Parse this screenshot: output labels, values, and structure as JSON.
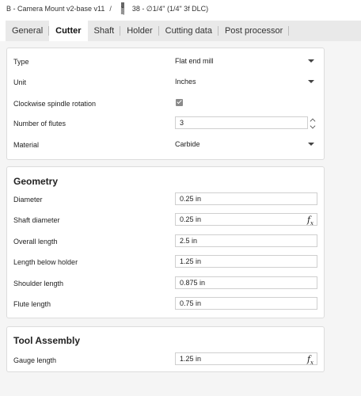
{
  "breadcrumb": {
    "document": "B - Camera Mount v2-base v11",
    "separator": "/",
    "tool": "38 - ∅1/4\" (1/4\" 3f DLC)"
  },
  "tabs": [
    {
      "label": "General",
      "active": false
    },
    {
      "label": "Cutter",
      "active": true
    },
    {
      "label": "Shaft",
      "active": false
    },
    {
      "label": "Holder",
      "active": false
    },
    {
      "label": "Cutting data",
      "active": false
    },
    {
      "label": "Post processor",
      "active": false
    }
  ],
  "cutter": {
    "type_label": "Type",
    "type_value": "Flat end mill",
    "unit_label": "Unit",
    "unit_value": "Inches",
    "clockwise_label": "Clockwise spindle rotation",
    "clockwise_checked": true,
    "flutes_label": "Number of flutes",
    "flutes_value": "3",
    "material_label": "Material",
    "material_value": "Carbide"
  },
  "geometry": {
    "title": "Geometry",
    "diameter_label": "Diameter",
    "diameter_value": "0.25 in",
    "shaft_diameter_label": "Shaft diameter",
    "shaft_diameter_value": "0.25 in",
    "overall_length_label": "Overall length",
    "overall_length_value": "2.5 in",
    "length_below_holder_label": "Length below holder",
    "length_below_holder_value": "1.25 in",
    "shoulder_length_label": "Shoulder length",
    "shoulder_length_value": "0.875 in",
    "flute_length_label": "Flute length",
    "flute_length_value": "0.75 in"
  },
  "assembly": {
    "title": "Tool Assembly",
    "gauge_length_label": "Gauge length",
    "gauge_length_value": "1.25 in"
  },
  "fx_label": "fx"
}
